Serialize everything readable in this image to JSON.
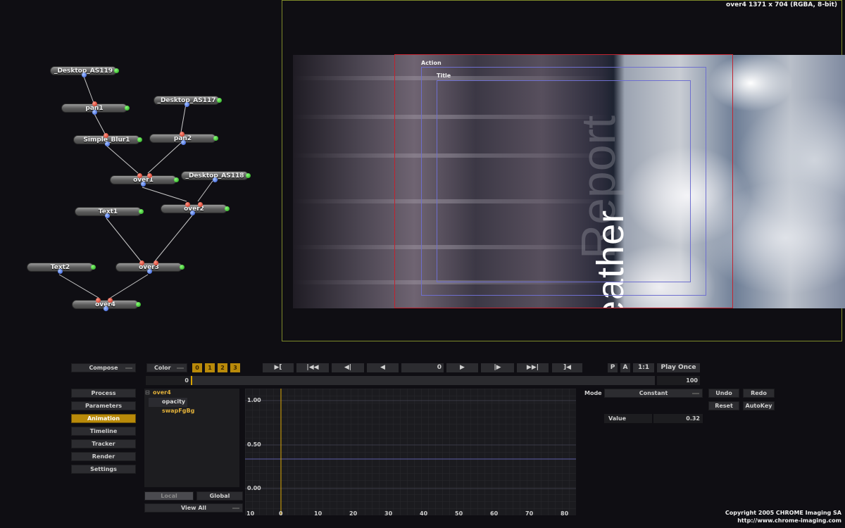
{
  "viewer": {
    "info": "over4 1371 x 704 (RGBA, 8-bit)",
    "action_label": "Action",
    "title_label": "Title",
    "image_text_1": "Weather",
    "image_text_2": "Report"
  },
  "nodes": [
    {
      "id": "desktop_as119",
      "label": "_Desktop_AS119"
    },
    {
      "id": "pan1",
      "label": "pan1"
    },
    {
      "id": "desktop_as117",
      "label": "_Desktop_AS117"
    },
    {
      "id": "simple_blur1",
      "label": "Simple_Blur1"
    },
    {
      "id": "pan2",
      "label": "pan2"
    },
    {
      "id": "over1",
      "label": "over1"
    },
    {
      "id": "desktop_as118",
      "label": "_Desktop_AS118"
    },
    {
      "id": "over2",
      "label": "over2"
    },
    {
      "id": "text1",
      "label": "Text1"
    },
    {
      "id": "text2",
      "label": "Text2"
    },
    {
      "id": "over3",
      "label": "over3"
    },
    {
      "id": "over4",
      "label": "over4"
    }
  ],
  "left_menu": {
    "compose": "Compose",
    "items": [
      "Process",
      "Parameters",
      "Animation",
      "Timeline",
      "Tracker",
      "Render",
      "Settings"
    ],
    "active": "Animation"
  },
  "color": {
    "label": "Color",
    "channels": [
      "0",
      "1",
      "2",
      "3"
    ]
  },
  "playback": {
    "frame": "0",
    "p": "P",
    "a": "A",
    "ratio": "1:1",
    "play_once": "Play Once",
    "timeline_start": "0",
    "timeline_end": "100"
  },
  "tree": {
    "root": "over4",
    "items": [
      "opacity",
      "swapFgBg"
    ]
  },
  "tree_tabs": {
    "local": "Local",
    "global": "Global",
    "view_all": "View All"
  },
  "curve": {
    "y_labels": [
      "1.00",
      "0.50",
      "0.00"
    ],
    "x_labels": [
      "10",
      "0",
      "10",
      "20",
      "30",
      "40",
      "50",
      "60",
      "70",
      "80"
    ],
    "current_frame": 0,
    "curve_color": "#5f5faa",
    "playhead_color": "#d9a400"
  },
  "mode": {
    "label": "Mode",
    "value": "Constant"
  },
  "actions": {
    "undo": "Undo",
    "redo": "Redo",
    "reset": "Reset",
    "autokey": "AutoKey"
  },
  "value": {
    "label": "Value",
    "value": "0.32"
  },
  "copyright": {
    "line1": "Copyright 2005 CHROME Imaging SA",
    "line2": "http://www.chrome-imaging.com"
  },
  "colors": {
    "accent": "#b98a0a",
    "viewer_border": "#7d8a2a",
    "safe_red": "#c2232f",
    "safe_blue": "#6e6fcf"
  }
}
